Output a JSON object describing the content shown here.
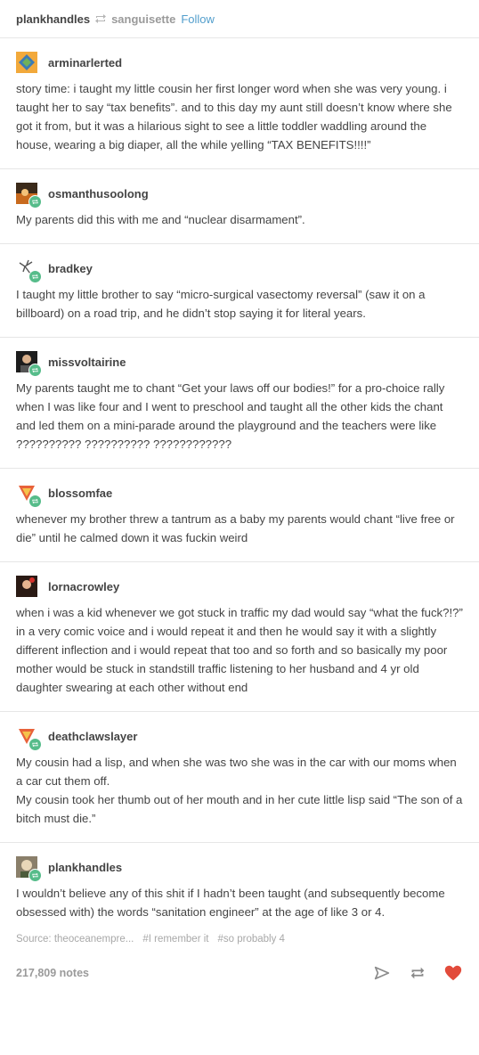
{
  "header": {
    "poster": "plankhandles",
    "reblogged_from": "sanguisette",
    "follow_label": "Follow"
  },
  "posts": [
    {
      "username": "arminarlerted",
      "text": "story time: i taught my little cousin her first longer word when she was very young. i taught her to say “tax benefits”. and to this day my aunt still doesn’t know where she got it from, but it was a hilarious sight to see a little toddler waddling around the house, wearing a big diaper, all the while yelling “TAX BENEFITS!!!!”"
    },
    {
      "username": "osmanthusoolong",
      "text": "My parents did this with me and “nuclear disarmament”."
    },
    {
      "username": "bradkey",
      "text": "I taught my little brother to say “micro-surgical vasectomy reversal” (saw it on a billboard) on a road trip, and he didn’t stop saying it for literal years."
    },
    {
      "username": "missvoltairine",
      "text": "My parents taught me to chant “Get your laws off our bodies!” for a pro-choice rally when I was like four and I went to preschool and taught all the other kids the chant and led them on a mini-parade around the playground and the teachers were like ?????????? ?????????? ????????????"
    },
    {
      "username": "blossomfae",
      "text": "whenever my brother threw a tantrum as a baby my parents would chant “live free or die” until he calmed down it was fuckin weird"
    },
    {
      "username": "lornacrowley",
      "text": "when i was a kid whenever we got stuck in traffic my dad would say “what the fuck?!?” in a very comic voice and i would repeat it and then he would say it with a slightly different inflection and i would repeat that too and so forth and so basically my poor mother would be stuck in standstill traffic listening to her husband and 4 yr old daughter swearing at each other without end"
    },
    {
      "username": "deathclawslayer",
      "text": "My cousin had a lisp, and when she was two she was in the car with our moms when a car cut them off.\nMy cousin took her thumb out of her mouth and in her cute little lisp said “The son of a bitch must die.”"
    },
    {
      "username": "plankhandles",
      "text": "I wouldn’t believe any of this shit if I hadn’t been taught (and subsequently become obsessed with) the words “sanitation engineer” at the age of like 3 or 4."
    }
  ],
  "source": {
    "label": "Source: theoceanempre...",
    "tags": [
      "#I remember it",
      "#so probably 4"
    ]
  },
  "footer": {
    "notes": "217,809 notes"
  },
  "colors": {
    "accent": "#529ecc",
    "reblog_green": "#56bc8a",
    "like_red": "#e24b3b"
  }
}
